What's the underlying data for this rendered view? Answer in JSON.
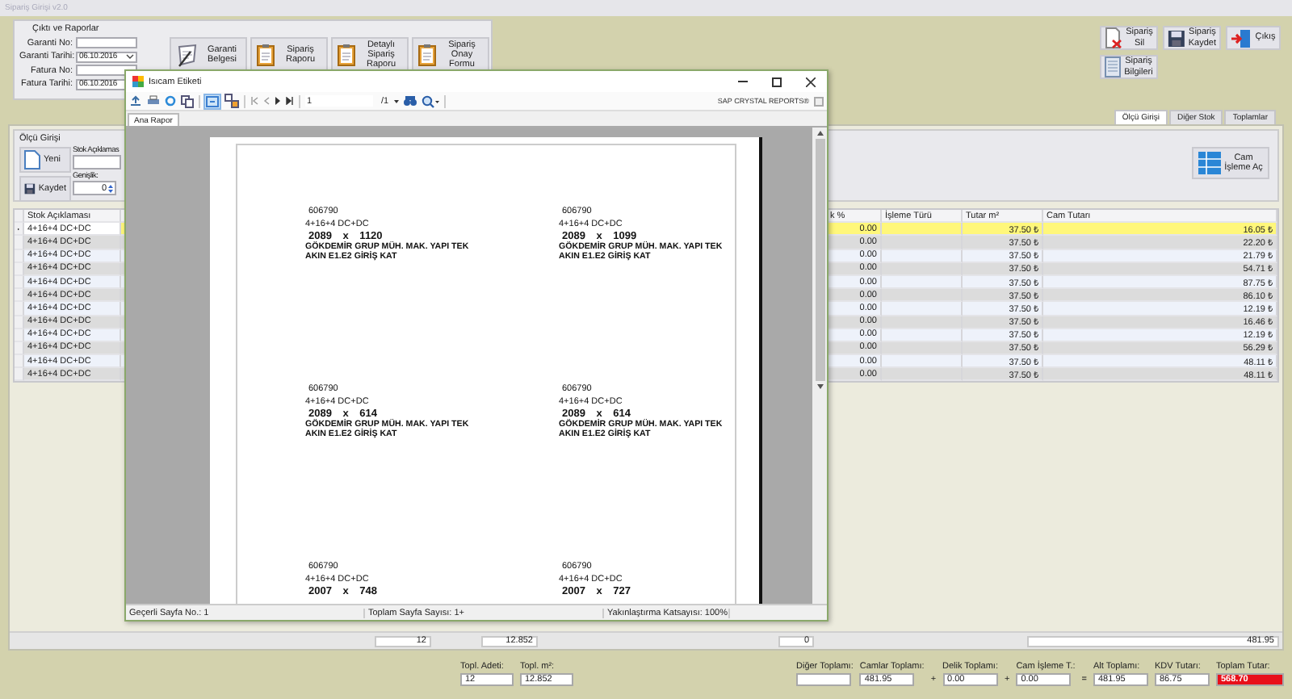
{
  "window": {
    "title": "Sipariş Girişi v2.0"
  },
  "reports_group": {
    "title": "Çıktı ve Raporlar",
    "fields": [
      {
        "label": "Garanti No:",
        "kind": "text"
      },
      {
        "label": "Garanti Tarihi:",
        "value": "06.10.2016",
        "kind": "date"
      },
      {
        "label": "Fatura No:",
        "kind": "text"
      },
      {
        "label": "Fatura Tarihi:",
        "value": "06.10.2016",
        "kind": "date"
      }
    ],
    "buttons": [
      "Garanti Belgesi",
      "Sipariş Raporu",
      "Detaylı Sipariş Raporu",
      "Sipariş Onay Formu"
    ]
  },
  "action_buttons": [
    "Sipariş Sil",
    "Sipariş Kaydet",
    "Çıkış",
    "Sipariş Bilgileri"
  ],
  "tabs": [
    {
      "label": "Ölçü Girişi",
      "selected": true
    },
    {
      "label": "Diğer Stok",
      "selected": false
    },
    {
      "label": "Toplamlar",
      "selected": false
    }
  ],
  "entry_group": {
    "title": "Ölçü Girişi",
    "buttons": [
      "Yeni",
      "Kaydet"
    ],
    "stock_label": "Stok Açıklamas",
    "width_label": "Genişlik:",
    "width_value": "0",
    "process_button": "Cam İşleme Aç"
  },
  "table": {
    "columns": [
      "Stok Açıklaması",
      "k %",
      "İşleme Türü",
      "Tutar m²",
      "Cam Tutarı"
    ],
    "rows": [
      {
        "selected": true,
        "stock": "4+16+4 DC+DC",
        "pct": "0.00",
        "unit_price": "37.50 ₺",
        "total": "16.05 ₺"
      },
      {
        "selected": false,
        "stock": "4+16+4 DC+DC",
        "pct": "0.00",
        "unit_price": "37.50 ₺",
        "total": "22.20 ₺"
      },
      {
        "selected": false,
        "stock": "4+16+4 DC+DC",
        "pct": "0.00",
        "unit_price": "37.50 ₺",
        "total": "21.79 ₺"
      },
      {
        "selected": false,
        "stock": "4+16+4 DC+DC",
        "pct": "0.00",
        "unit_price": "37.50 ₺",
        "total": "54.71 ₺"
      },
      {
        "selected": false,
        "stock": "4+16+4 DC+DC",
        "pct": "0.00",
        "unit_price": "37.50 ₺",
        "total": "87.75 ₺"
      },
      {
        "selected": false,
        "stock": "4+16+4 DC+DC",
        "pct": "0.00",
        "unit_price": "37.50 ₺",
        "total": "86.10 ₺"
      },
      {
        "selected": false,
        "stock": "4+16+4 DC+DC",
        "pct": "0.00",
        "unit_price": "37.50 ₺",
        "total": "12.19 ₺"
      },
      {
        "selected": false,
        "stock": "4+16+4 DC+DC",
        "pct": "0.00",
        "unit_price": "37.50 ₺",
        "total": "16.46 ₺"
      },
      {
        "selected": false,
        "stock": "4+16+4 DC+DC",
        "pct": "0.00",
        "unit_price": "37.50 ₺",
        "total": "12.19 ₺"
      },
      {
        "selected": false,
        "stock": "4+16+4 DC+DC",
        "pct": "0.00",
        "unit_price": "37.50 ₺",
        "total": "56.29 ₺"
      },
      {
        "selected": false,
        "stock": "4+16+4 DC+DC",
        "pct": "0.00",
        "unit_price": "37.50 ₺",
        "total": "48.11 ₺"
      },
      {
        "selected": false,
        "stock": "4+16+4 DC+DC",
        "pct": "0.00",
        "unit_price": "37.50 ₺",
        "total": "48.11 ₺"
      }
    ]
  },
  "sum_row": [
    "12",
    "12.852",
    "0",
    "481.95"
  ],
  "counts": [
    {
      "label": "Topl. Adeti:",
      "value": "12"
    },
    {
      "label": "Topl. m²:",
      "value": "12.852"
    }
  ],
  "summary": [
    {
      "label": "Diğer Toplamı:",
      "kind": "plain"
    },
    {
      "label": "Camlar Toplamı:",
      "value": "481.95",
      "kind": "plain",
      "operator": "+"
    },
    {
      "label": "Delik Toplamı:",
      "value": "0.00",
      "kind": "plain",
      "operator": "+"
    },
    {
      "label": "Cam İşleme T.:",
      "value": "0.00",
      "kind": "plain",
      "operator": "="
    },
    {
      "label": "Alt Toplamı:",
      "value": "481.95",
      "kind": "plain"
    },
    {
      "label": "KDV Tutarı:",
      "value": "86.75",
      "kind": "plain"
    },
    {
      "label": "Toplam Tutar:",
      "value": "568.70",
      "kind": "total"
    }
  ],
  "dialog": {
    "title": "Isıcam Etiketi",
    "page_field": "1",
    "page_count": "/1",
    "brand": "SAP CRYSTAL REPORTS®",
    "tab": "Ana Rapor",
    "labels": [
      {
        "code": "606790",
        "glass": "4+16+4 DC+DC",
        "size": "2089 x 1120",
        "company": "GÖKDEMİR GRUP MÜH. MAK. YAPI TEK",
        "site": "AKIN E1.E2 GİRİŞ KAT"
      },
      {
        "code": "606790",
        "glass": "4+16+4 DC+DC",
        "size": "2089 x 1099",
        "company": "GÖKDEMİR GRUP MÜH. MAK. YAPI TEK",
        "site": "AKIN E1.E2 GİRİŞ KAT"
      },
      {
        "code": "606790",
        "glass": "4+16+4 DC+DC",
        "size": "2089 x 614",
        "company": "GÖKDEMİR GRUP MÜH. MAK. YAPI TEK",
        "site": "AKIN E1.E2 GİRİŞ KAT"
      },
      {
        "code": "606790",
        "glass": "4+16+4 DC+DC",
        "size": "2089 x 614",
        "company": "GÖKDEMİR GRUP MÜH. MAK. YAPI TEK",
        "site": "AKIN E1.E2 GİRİŞ KAT"
      },
      {
        "code": "606790",
        "glass": "4+16+4 DC+DC",
        "size": "2007 x 748"
      },
      {
        "code": "606790",
        "glass": "4+16+4 DC+DC",
        "size": "2007 x 727"
      }
    ],
    "status": [
      "Geçerli Sayfa No.: 1",
      "Toplam Sayfa Sayısı: 1+",
      "Yakınlaştırma Katsayısı: 100%"
    ]
  }
}
